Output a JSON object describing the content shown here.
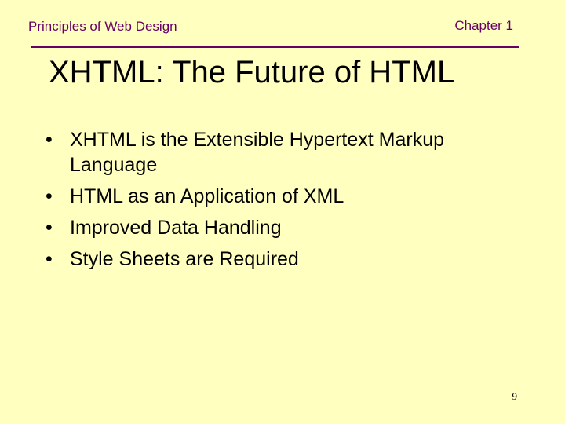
{
  "header": {
    "course_title": "Principles of Web Design",
    "chapter": "Chapter 1"
  },
  "slide": {
    "title": "XHTML: The Future of HTML",
    "bullet_glyph": "•",
    "bullets": [
      "XHTML is the Extensible Hypertext Markup Language",
      "HTML as an Application of XML",
      "Improved Data Handling",
      "Style Sheets are Required"
    ],
    "page_number": "9"
  },
  "colors": {
    "background": "#ffffc0",
    "accent": "#660066",
    "text": "#000000"
  }
}
